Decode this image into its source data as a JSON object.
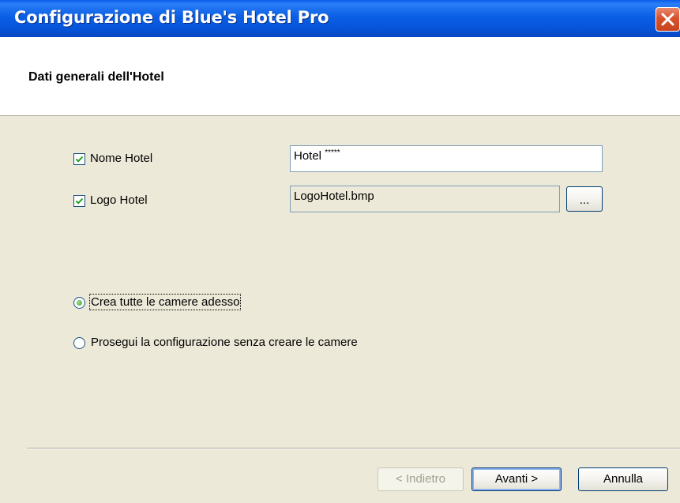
{
  "window": {
    "title": "Configurazione di Blue's Hotel Pro"
  },
  "header": {
    "title": "Dati generali dell'Hotel"
  },
  "fields": {
    "hotel_name": {
      "label": "Nome Hotel",
      "checked": true,
      "value": "Hotel",
      "stars": "*****"
    },
    "hotel_logo": {
      "label": "Logo Hotel",
      "checked": true,
      "value": "LogoHotel.bmp",
      "browse_label": "..."
    }
  },
  "options": {
    "create_rooms_now": {
      "label": "Crea tutte le camere adesso",
      "selected": true
    },
    "continue_without_rooms": {
      "label": "Prosegui la configurazione senza creare le camere",
      "selected": false
    }
  },
  "footer": {
    "back_label": "< Indietro",
    "next_label": "Avanti >",
    "cancel_label": "Annulla"
  },
  "colors": {
    "titlebar": "#0A5FE4",
    "dialog_bg": "#ECE9D8",
    "check_mark": "#21A121",
    "close_button": "#D8512D"
  }
}
